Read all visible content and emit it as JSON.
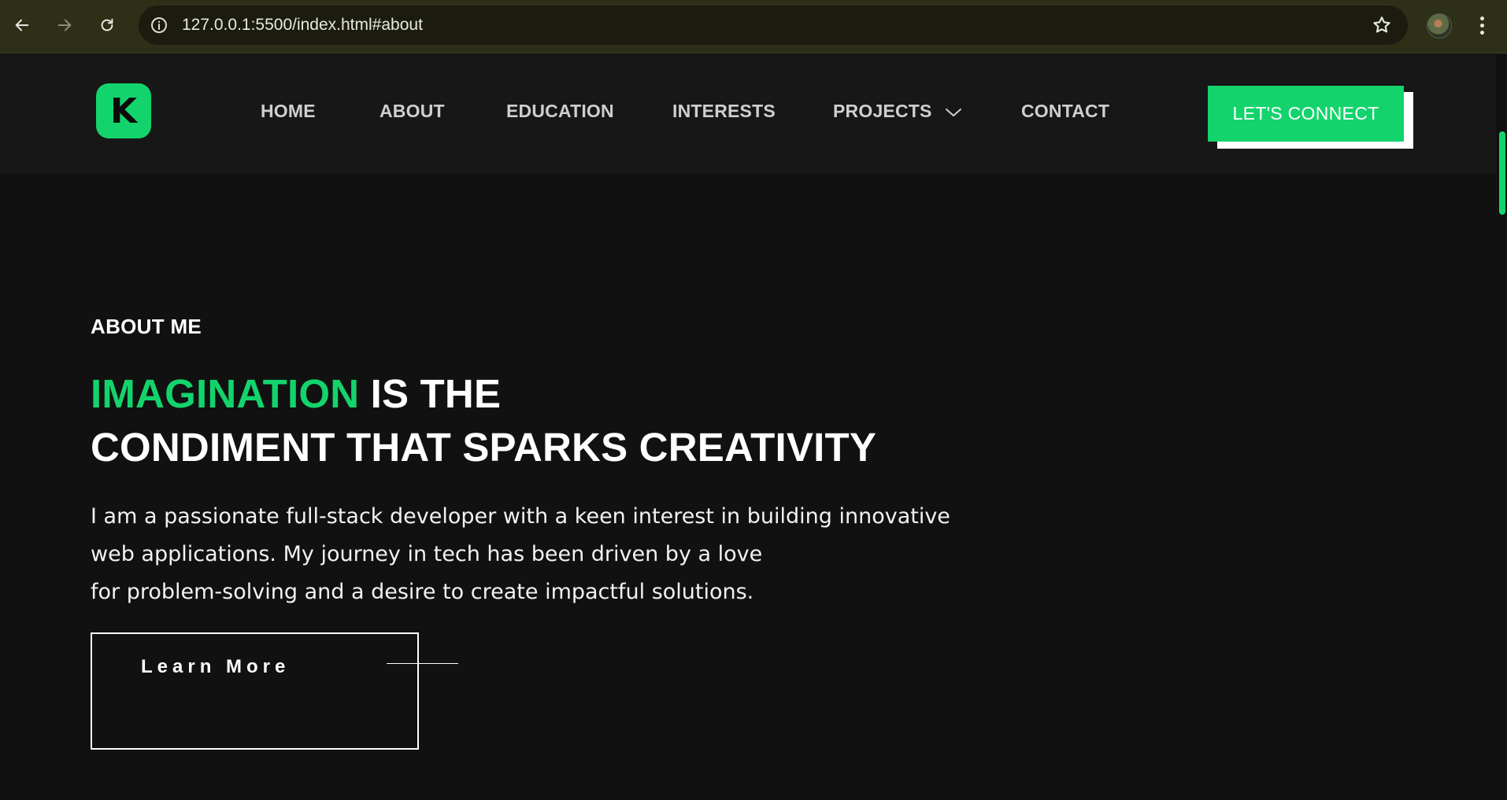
{
  "browser": {
    "url": "127.0.0.1:5500/index.html#about",
    "back_icon": "arrow-left-icon",
    "forward_icon": "arrow-right-icon",
    "reload_icon": "reload-icon",
    "info_icon": "info-icon",
    "bookmark_icon": "star-icon",
    "menu_icon": "kebab-menu-icon"
  },
  "site": {
    "logo_letter": "K",
    "accent_color": "#13d46c",
    "nav": [
      "HOME",
      "ABOUT",
      "EDUCATION",
      "INTERESTS",
      "PROJECTS",
      "CONTACT"
    ],
    "cta": "LET'S CONNECT"
  },
  "about": {
    "eyebrow": "ABOUT ME",
    "headline_accent": "IMAGINATION",
    "headline_rest": " IS THE",
    "headline_line2": "CONDIMENT THAT SPARKS CREATIVITY",
    "paragraph_lines": [
      "I am a passionate full-stack developer with a keen interest in building innovative",
      "web applications. My journey in tech has been driven by a love",
      "for problem-solving and a desire to create impactful solutions."
    ],
    "button": "Learn More"
  }
}
